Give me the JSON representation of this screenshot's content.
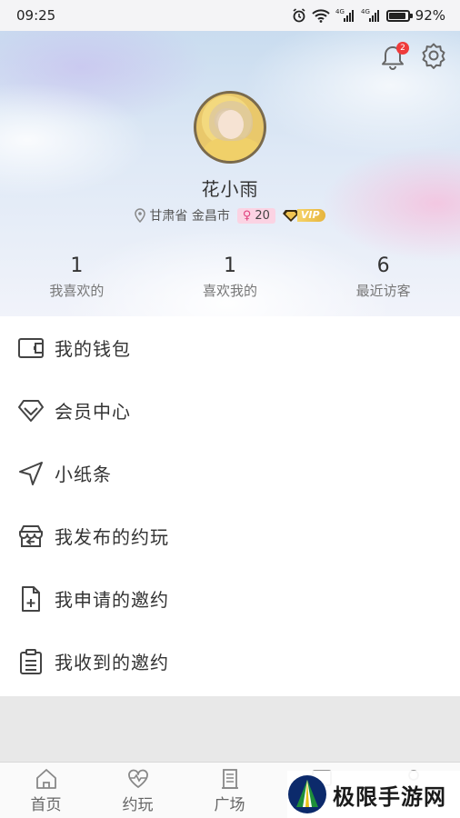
{
  "status_bar": {
    "time": "09:25",
    "network_1": "4G",
    "network_2": "4G",
    "battery_percent": 92,
    "battery_label": "92%"
  },
  "header": {
    "notification_count": "2",
    "username": "花小雨",
    "location": "甘肃省 金昌市",
    "gender_symbol": "♀",
    "age": "20",
    "vip_label": "VIP"
  },
  "stats": [
    {
      "value": "1",
      "label": "我喜欢的"
    },
    {
      "value": "1",
      "label": "喜欢我的"
    },
    {
      "value": "6",
      "label": "最近访客"
    }
  ],
  "menu": [
    {
      "label": "我的钱包",
      "icon": "wallet-icon"
    },
    {
      "label": "会员中心",
      "icon": "diamond-icon"
    },
    {
      "label": "小纸条",
      "icon": "send-arrow-icon"
    },
    {
      "label": "我发布的约玩",
      "icon": "store-icon"
    },
    {
      "label": "我申请的邀约",
      "icon": "file-add-icon"
    },
    {
      "label": "我收到的邀约",
      "icon": "clipboard-icon"
    }
  ],
  "tabs": [
    {
      "label": "首页",
      "icon": "home-icon"
    },
    {
      "label": "约玩",
      "icon": "heartbeat-icon"
    },
    {
      "label": "广场",
      "icon": "square-icon"
    },
    {
      "label": "",
      "icon": "message-icon"
    },
    {
      "label": "",
      "icon": "profile-icon"
    }
  ],
  "watermark": {
    "text": "极限手游网"
  }
}
